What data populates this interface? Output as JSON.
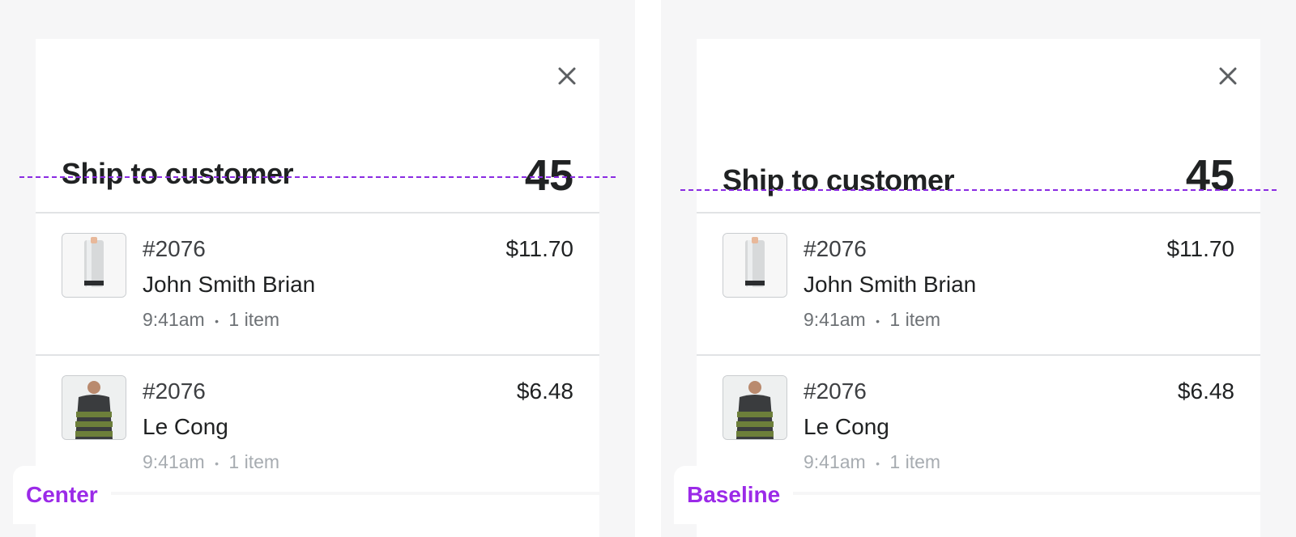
{
  "panels": [
    {
      "tag_label": "Center",
      "title": "Ship to customer",
      "count": "45",
      "orders": [
        {
          "number": "#2076",
          "customer": "John Smith Brian",
          "price": "$11.70",
          "time": "9:41am",
          "items": "1 item",
          "thumbnail": "speaker-product-image"
        },
        {
          "number": "#2076",
          "customer": "Le Cong",
          "price": "$6.48",
          "time": "9:41am",
          "items": "1 item",
          "thumbnail": "sweater-product-image"
        }
      ]
    },
    {
      "tag_label": "Baseline",
      "title": "Ship to customer",
      "count": "45",
      "orders": [
        {
          "number": "#2076",
          "customer": "John Smith Brian",
          "price": "$11.70",
          "time": "9:41am",
          "items": "1 item",
          "thumbnail": "speaker-product-image"
        },
        {
          "number": "#2076",
          "customer": "Le Cong",
          "price": "$6.48",
          "time": "9:41am",
          "items": "1 item",
          "thumbnail": "sweater-product-image"
        }
      ]
    }
  ],
  "meta_separator": "•",
  "colors": {
    "guide_line": "#8a2be2",
    "tag_text": "#9b2ae8",
    "panel_background": "#f6f6f7",
    "sheet_background": "#ffffff",
    "divider": "#e1e3e5"
  },
  "icons": {
    "close": "close-icon"
  }
}
